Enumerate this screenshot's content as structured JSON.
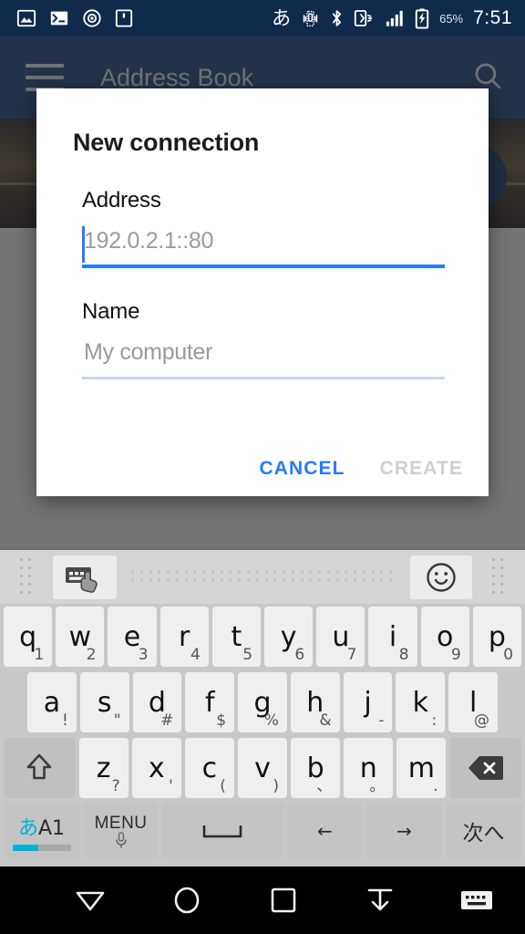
{
  "status_bar": {
    "left_icons": [
      "image-icon",
      "terminal-icon",
      "disc-icon",
      "sim-card-icon"
    ],
    "right_icons": [
      "ime-japanese-icon",
      "vibrate-icon",
      "bluetooth-icon",
      "nfc-icon",
      "signal-icon",
      "battery-charging-icon"
    ],
    "ime_label": "あ",
    "battery_percent": "65%",
    "clock": "7:51"
  },
  "app": {
    "title": "Address Book",
    "menu_icon": "hamburger-menu-icon",
    "search_icon": "search-icon",
    "fab_icon": "add-icon"
  },
  "dialog": {
    "title": "New connection",
    "fields": [
      {
        "label": "Address",
        "value": "",
        "placeholder": "192.0.2.1::80",
        "focused": true
      },
      {
        "label": "Name",
        "value": "",
        "placeholder": "My computer",
        "focused": false
      }
    ],
    "cancel_label": "CANCEL",
    "create_label": "CREATE",
    "accent_color": "#2979ff",
    "disabled_color": "#cfcfcf"
  },
  "keyboard": {
    "toolbar": {
      "left_icon": "keyboard-gesture-icon",
      "right_icon": "emoji-icon"
    },
    "row1": [
      {
        "main": "q",
        "sub": "1"
      },
      {
        "main": "w",
        "sub": "2"
      },
      {
        "main": "e",
        "sub": "3"
      },
      {
        "main": "r",
        "sub": "4"
      },
      {
        "main": "t",
        "sub": "5"
      },
      {
        "main": "y",
        "sub": "6"
      },
      {
        "main": "u",
        "sub": "7"
      },
      {
        "main": "i",
        "sub": "8"
      },
      {
        "main": "o",
        "sub": "9"
      },
      {
        "main": "p",
        "sub": "0"
      }
    ],
    "row2": [
      {
        "main": "a",
        "sub": "!"
      },
      {
        "main": "s",
        "sub": "\""
      },
      {
        "main": "d",
        "sub": "#"
      },
      {
        "main": "f",
        "sub": "$"
      },
      {
        "main": "g",
        "sub": "%"
      },
      {
        "main": "h",
        "sub": "&"
      },
      {
        "main": "j",
        "sub": "-"
      },
      {
        "main": "k",
        "sub": ":"
      },
      {
        "main": "l",
        "sub": "@"
      }
    ],
    "row3": [
      {
        "main": "z",
        "sub": "?"
      },
      {
        "main": "x",
        "sub": "'"
      },
      {
        "main": "c",
        "sub": "("
      },
      {
        "main": "v",
        "sub": ")"
      },
      {
        "main": "b",
        "sub": "、"
      },
      {
        "main": "n",
        "sub": "。"
      },
      {
        "main": "m",
        "sub": "."
      }
    ],
    "shift_icon": "shift-icon",
    "backspace_icon": "backspace-icon",
    "row4": {
      "ime_jp": "あ",
      "ime_en": "A1",
      "menu_label": "MENU",
      "menu_icon": "microphone-icon",
      "space_icon": "space-icon",
      "left_arrow": "←",
      "right_arrow": "→",
      "enter_label": "次へ"
    }
  },
  "nav_bar": {
    "buttons": [
      "back-hide-keyboard-icon",
      "home-icon",
      "recents-icon",
      "download-icon",
      "keyboard-switch-icon"
    ]
  }
}
